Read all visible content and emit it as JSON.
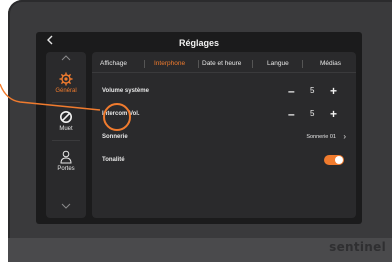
{
  "header": {
    "title": "Réglages",
    "back_icon": "chevron-left-icon"
  },
  "sidebar": {
    "items": [
      {
        "label": "Général",
        "icon": "gear-icon",
        "active": true
      },
      {
        "label": "Muet",
        "icon": "mute-icon",
        "active": false
      },
      {
        "label": "Portes",
        "icon": "person-icon",
        "active": false
      }
    ]
  },
  "tabs": [
    {
      "label": "Affichage",
      "active": false
    },
    {
      "label": "Interphone",
      "active": true
    },
    {
      "label": "Date et heure",
      "active": false
    },
    {
      "label": "Langue",
      "active": false
    },
    {
      "label": "Médias",
      "active": false
    }
  ],
  "settings": {
    "volume_systeme": {
      "label": "Volume système",
      "value": "5",
      "minus": "–",
      "plus": "+"
    },
    "intercom_vol": {
      "label": "Intercom Vol.",
      "value": "5",
      "minus": "–",
      "plus": "+"
    },
    "sonnerie": {
      "label": "Sonnerie",
      "value": "Sonnerie 01",
      "chevron": "›"
    },
    "tonalite": {
      "label": "Tonalité",
      "enabled": true
    }
  },
  "brand": "sentinel",
  "colors": {
    "accent": "#f07b2e",
    "screen_bg": "#1b1b1c",
    "panel_bg": "#2a2a2c",
    "bezel": "#3a3a3c"
  }
}
